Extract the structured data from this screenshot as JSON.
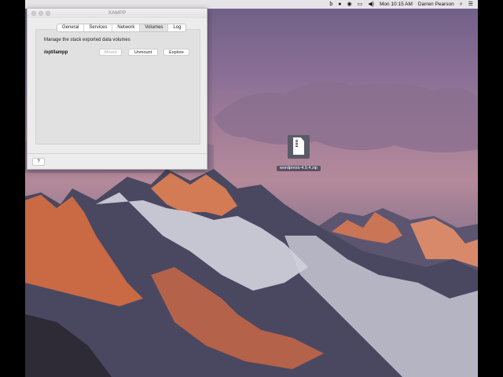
{
  "menubar": {
    "items": [
      "b",
      "●",
      "◉",
      "▭",
      "◀)",
      "Mon 10:15 AM",
      "Darren Pearson",
      "⌕",
      "☰"
    ],
    "icons": [
      "bluetooth-icon",
      "record-icon",
      "airplay-icon",
      "display-icon",
      "volume-icon",
      "clock",
      "user-name",
      "spotlight-icon",
      "notification-center-icon"
    ]
  },
  "window": {
    "title": "XAMPP",
    "tabs": [
      "General",
      "Services",
      "Network",
      "Volumes",
      "Log"
    ],
    "active_tab": "Volumes",
    "panel_description": "Manage the stack exported data volumes",
    "volume_path": "/opt/lampp",
    "buttons": {
      "mount": "Mount",
      "unmount": "Unmount",
      "explore": "Explore"
    },
    "help": "?"
  },
  "desktop": {
    "file_label": "wordpress-4.9.4.zip"
  },
  "colors": {
    "window_bg": "#ececec",
    "panel_bg": "#e1e1e1",
    "mount_disabled": "#aaaaaa"
  }
}
